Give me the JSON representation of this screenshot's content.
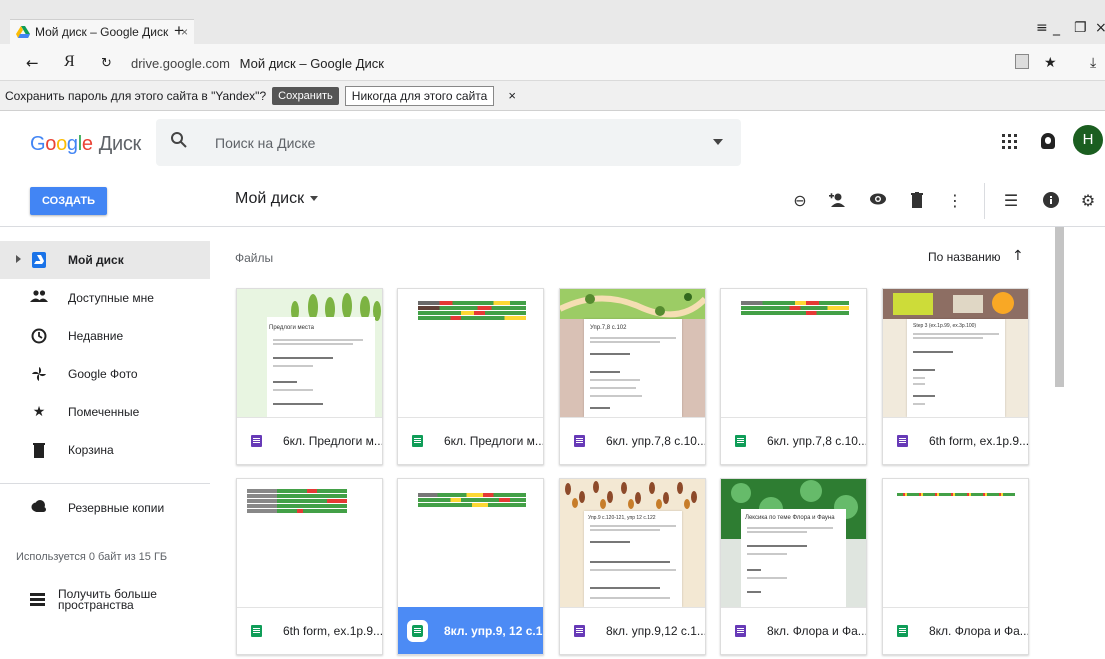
{
  "browser": {
    "tab_title": "Мой диск – Google Диск",
    "tab_close": "×",
    "new_tab": "+",
    "host": "drive.google.com",
    "page_title": "Мой диск – Google Диск",
    "yandex_glyph": "Я"
  },
  "password_bar": {
    "prompt": "Сохранить пароль для этого сайта в \"Yandex\"?",
    "save": "Сохранить",
    "never": "Никогда для этого сайта",
    "close": "×"
  },
  "drive": {
    "logo_word": "Google",
    "logo_product": "Диск",
    "search_placeholder": "Поиск на Диске",
    "avatar_letter": "Н",
    "create": "СОЗДАТЬ",
    "location": "Мой диск"
  },
  "sidebar": {
    "items": [
      {
        "label": "Мой диск",
        "icon": "drive-icon"
      },
      {
        "label": "Доступные мне",
        "icon": "people-icon"
      },
      {
        "label": "Недавние",
        "icon": "clock-icon"
      },
      {
        "label": "Google Фото",
        "icon": "pinwheel-icon"
      },
      {
        "label": "Помеченные",
        "icon": "star-icon"
      },
      {
        "label": "Корзина",
        "icon": "trash-icon"
      }
    ],
    "backups": "Резервные копии",
    "usage": "Используется 0 байт из 15 ГБ",
    "get_more": "Получить больше пространства"
  },
  "files": {
    "section_label": "Файлы",
    "sort_label": "По названию",
    "items": [
      {
        "name": "6кл. Предлоги м...",
        "type": "form"
      },
      {
        "name": "6кл. Предлоги м...",
        "type": "sheet"
      },
      {
        "name": "6кл. упр.7,8 с.10...",
        "type": "form"
      },
      {
        "name": "6кл. упр.7,8 с.10...",
        "type": "sheet"
      },
      {
        "name": "6th form, ex.1p.9...",
        "type": "form"
      },
      {
        "name": "6th form, ex.1p.9...",
        "type": "sheet"
      },
      {
        "name": "8кл. упр.9, 12 с.1...",
        "type": "sheet",
        "selected": true
      },
      {
        "name": "8кл. упр.9,12 с.1...",
        "type": "form"
      },
      {
        "name": "8кл. Флора и Фа...",
        "type": "form"
      },
      {
        "name": "8кл. Флора и Фа...",
        "type": "sheet"
      }
    ],
    "thumb_titles": [
      "Предлоги места",
      "Упр.7,8 с.102",
      "Step 3 (ex.1p.99, ex.3p.100)",
      "Упр.9 с.120-121, упр 12 с.122",
      "Лексика по теме Флора и Фауна"
    ]
  },
  "colors": {
    "accent": "#4285f4",
    "selected_card": "#4c8bf5",
    "form": "#673ab7",
    "sheet": "#0f9d58",
    "avatar": "#1b5e20"
  }
}
